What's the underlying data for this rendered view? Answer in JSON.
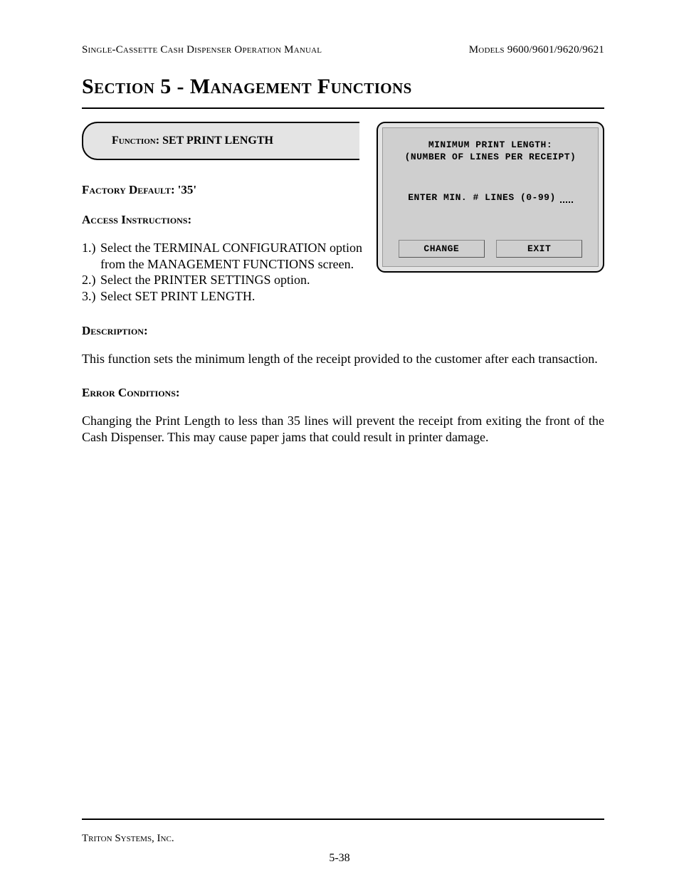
{
  "header": {
    "left": "Single-Cassette Cash Dispenser Operation Manual",
    "right": "Models 9600/9601/9620/9621"
  },
  "section_title": "Section 5 - Management Functions",
  "function_tab": {
    "label": "Function:",
    "name": "SET PRINT LENGTH"
  },
  "factory_default": {
    "label": "Factory Default:",
    "value": "'35'"
  },
  "access_label": "Access Instructions:",
  "steps": {
    "s1_num": "1.)",
    "s1_txt": "Select the TERMINAL CONFIGURATION option from the MANAGEMENT FUNCTIONS screen.",
    "s2_num": "2.)",
    "s2_txt": "Select the  PRINTER SETTINGS option.",
    "s3_num": "3.)",
    "s3_txt": "Select SET PRINT LENGTH."
  },
  "screen": {
    "line1": "MINIMUM PRINT LENGTH:",
    "line2": "(NUMBER OF LINES PER RECEIPT)",
    "prompt": "ENTER MIN. # LINES (0-99)",
    "btn_change": "CHANGE",
    "btn_exit": "EXIT"
  },
  "description": {
    "label": "Description:",
    "text": "This function sets the minimum length of the receipt provided to the customer after each transaction."
  },
  "errors": {
    "label": "Error Conditions:",
    "text": "Changing the Print Length to less than 35 lines will prevent the receipt from exiting the front of the Cash Dispenser.  This may cause paper jams that could result in printer damage."
  },
  "footer": {
    "company": "Triton Systems, Inc.",
    "page_num": "5-38"
  }
}
